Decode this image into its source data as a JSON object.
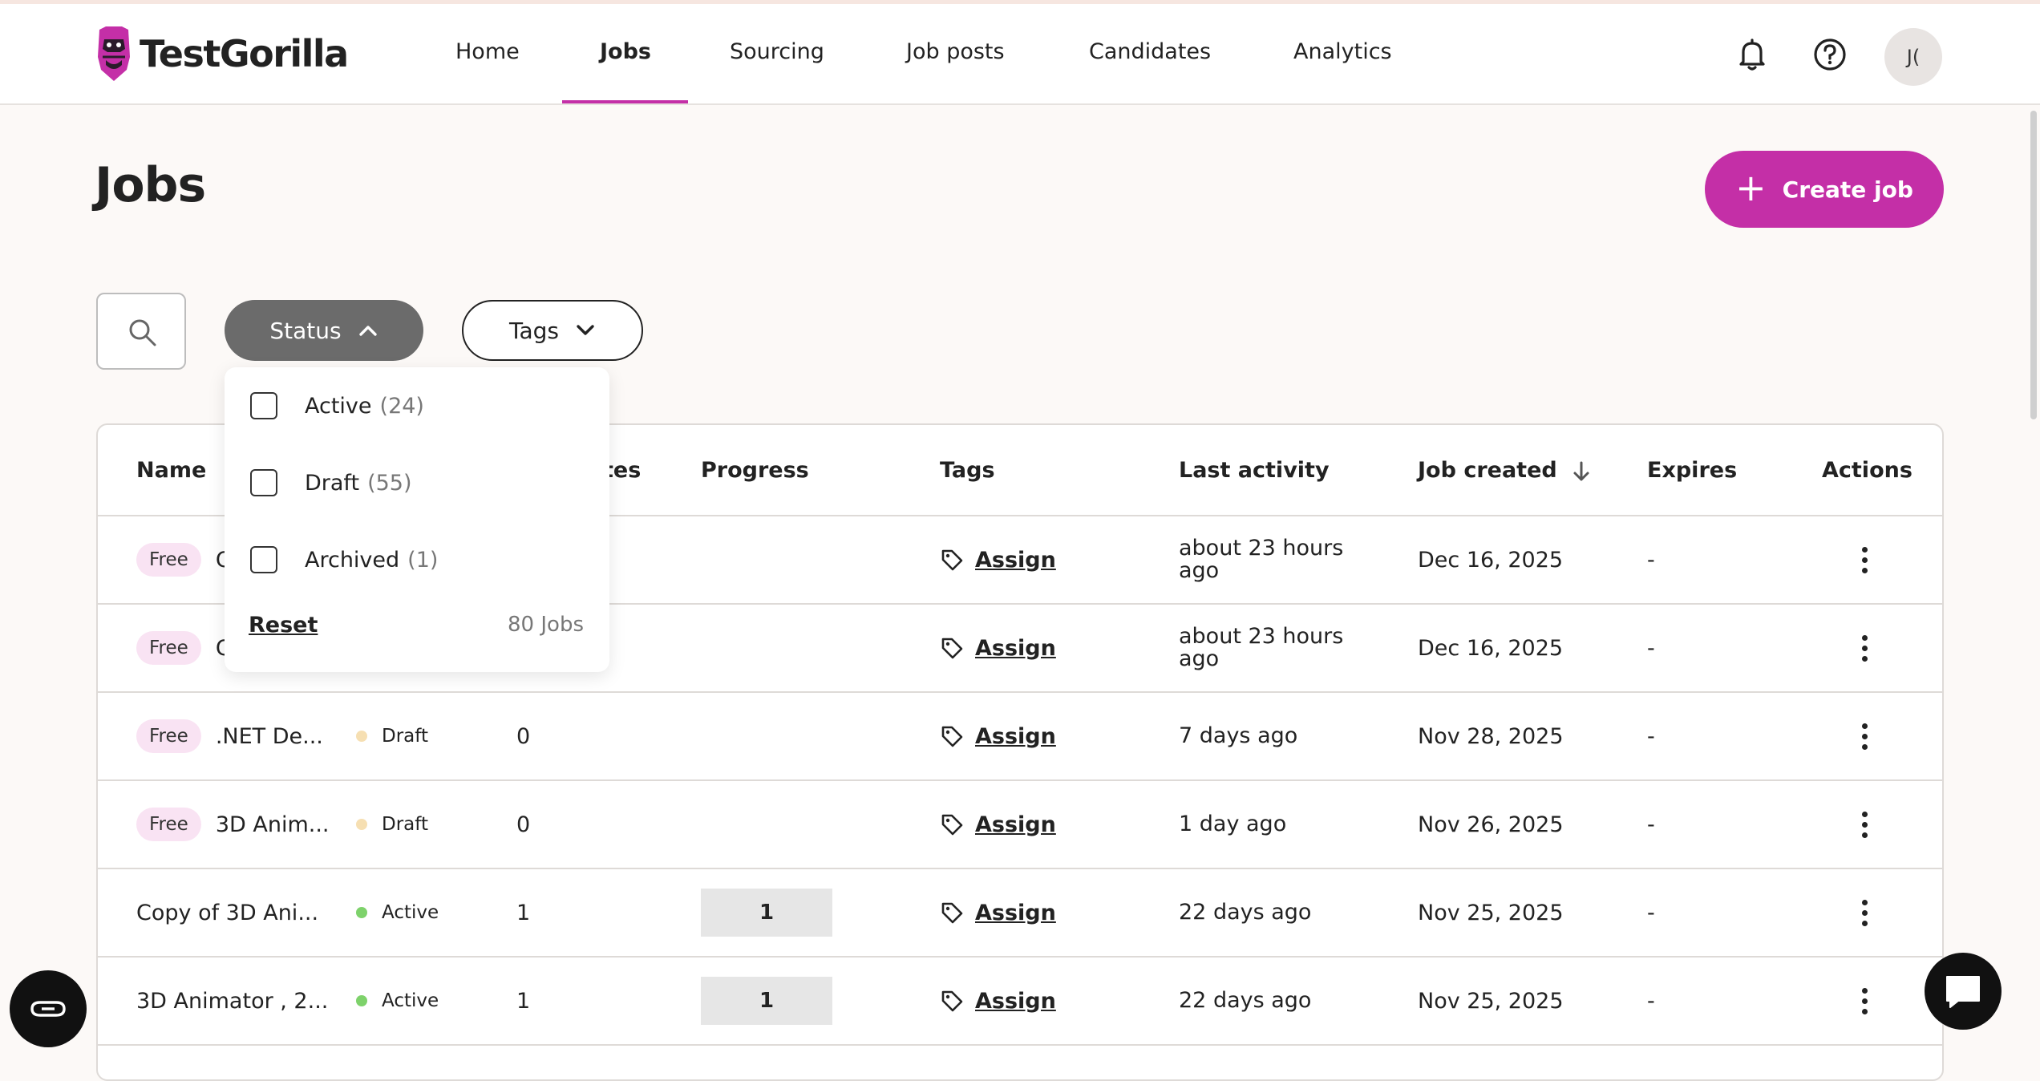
{
  "header": {
    "logo_text": "TestGorilla",
    "nav": [
      "Home",
      "Jobs",
      "Sourcing",
      "Job posts",
      "Candidates",
      "Analytics"
    ],
    "active_nav": "Jobs",
    "avatar_initials": "J("
  },
  "page": {
    "title": "Jobs",
    "create_label": "Create job"
  },
  "filters": {
    "status_label": "Status",
    "tags_label": "Tags"
  },
  "status_dropdown": {
    "options": [
      {
        "label": "Active",
        "count": "(24)",
        "checked": false
      },
      {
        "label": "Draft",
        "count": "(55)",
        "checked": false
      },
      {
        "label": "Archived",
        "count": "(1)",
        "checked": false
      }
    ],
    "reset_label": "Reset",
    "total": "80 Jobs"
  },
  "table": {
    "columns": {
      "name": "Name",
      "candidates_partial": "tes",
      "progress": "Progress",
      "tags": "Tags",
      "last_activity": "Last activity",
      "job_created": "Job created",
      "expires": "Expires",
      "actions": "Actions"
    },
    "rows": [
      {
        "badge": "Free",
        "name": "C",
        "status": "",
        "candidates": "",
        "progress": "",
        "tag_action": "Assign",
        "last_activity": "about 23 hours ago",
        "created": "Dec 16, 2025",
        "expires": "-"
      },
      {
        "badge": "Free",
        "name": "C",
        "status": "",
        "candidates": "",
        "progress": "",
        "tag_action": "Assign",
        "last_activity": "about 23 hours ago",
        "created": "Dec 16, 2025",
        "expires": "-"
      },
      {
        "badge": "Free",
        "name": ".NET De...",
        "status": "Draft",
        "candidates": "0",
        "progress": "",
        "tag_action": "Assign",
        "last_activity": "7 days ago",
        "created": "Nov 28, 2025",
        "expires": "-"
      },
      {
        "badge": "Free",
        "name": "3D Anim...",
        "status": "Draft",
        "candidates": "0",
        "progress": "",
        "tag_action": "Assign",
        "last_activity": "1 day ago",
        "created": "Nov 26, 2025",
        "expires": "-"
      },
      {
        "badge": "",
        "name": "Copy of 3D Ani...",
        "status": "Active",
        "candidates": "1",
        "progress": "1",
        "tag_action": "Assign",
        "last_activity": "22 days ago",
        "created": "Nov 25, 2025",
        "expires": "-"
      },
      {
        "badge": "",
        "name": "3D Animator , 2...",
        "status": "Active",
        "candidates": "1",
        "progress": "1",
        "tag_action": "Assign",
        "last_activity": "22 days ago",
        "created": "Nov 25, 2025",
        "expires": "-"
      }
    ]
  },
  "colors": {
    "brand": "#c42fa7",
    "draft_dot": "#f6dfb2",
    "active_dot": "#7ed26b",
    "free_badge_bg": "#f9e3f3"
  },
  "icons": [
    "logo-gorilla-icon",
    "bell-icon",
    "help-icon",
    "search-icon",
    "chevron-up-icon",
    "chevron-down-icon",
    "tag-icon",
    "kebab-menu-icon",
    "arrow-down-icon",
    "plus-icon",
    "loop-icon",
    "chat-icon"
  ]
}
